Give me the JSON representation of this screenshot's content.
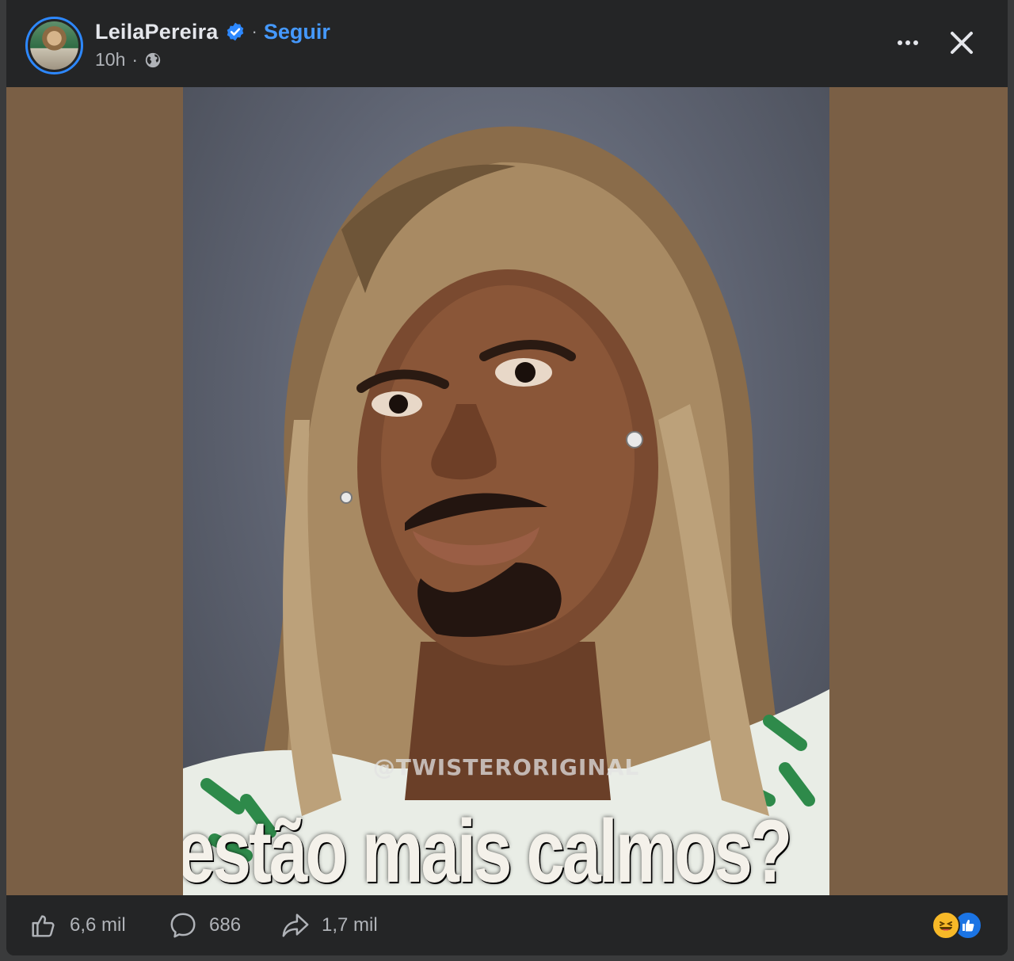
{
  "post": {
    "author": "LeilaPereira",
    "verified": true,
    "separator": "·",
    "follow_label": "Seguir",
    "time": "10h",
    "time_separator": "·",
    "audience_icon": "globe-icon",
    "options_icon": "more-options-icon",
    "close_icon": "close-icon"
  },
  "media": {
    "watermark": "@TWISTERORIGINAL",
    "caption": "estão mais calmos?"
  },
  "stats": {
    "likes": "6,6 mil",
    "comments": "686",
    "shares": "1,7 mil"
  },
  "reactions": [
    {
      "name": "haha",
      "icon": "haha-reaction-icon",
      "color": "#f7b928"
    },
    {
      "name": "like",
      "icon": "like-reaction-icon",
      "color": "#1b74e4"
    }
  ],
  "colors": {
    "background": "#242526",
    "text_primary": "#e4e6eb",
    "text_secondary": "#b0b3b8",
    "accent": "#4599ff",
    "media_letterbox": "#7a5f45"
  }
}
